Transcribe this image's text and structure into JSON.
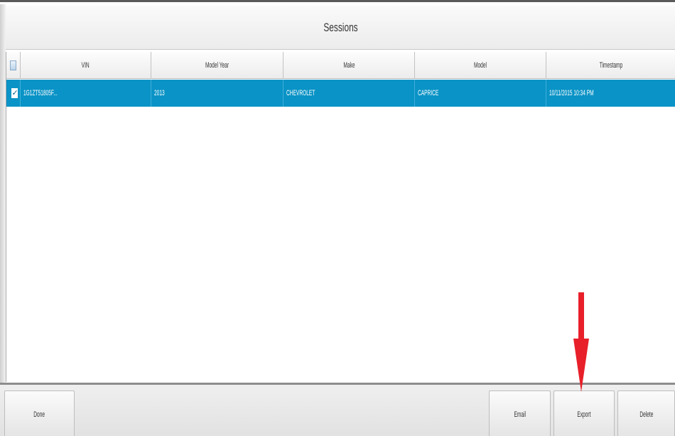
{
  "window": {
    "title": "Sessions"
  },
  "table": {
    "columns": [
      "VIN",
      "Model Year",
      "Make",
      "Model",
      "Timestamp"
    ],
    "rows": [
      {
        "checked": true,
        "cells": [
          "1G1ZT51805F...",
          "2013",
          "CHEVROLET",
          "CAPRICE",
          "10/11/2015 10:34 PM"
        ]
      }
    ]
  },
  "buttons": {
    "done": "Done",
    "email": "Email",
    "export": "Export",
    "delete": "Delete"
  },
  "colors": {
    "selection": "#0a93c6",
    "annotation_arrow": "#e8202a"
  },
  "icons": {
    "checkbox_checked": "✓",
    "annotation": "red-arrow-down"
  }
}
